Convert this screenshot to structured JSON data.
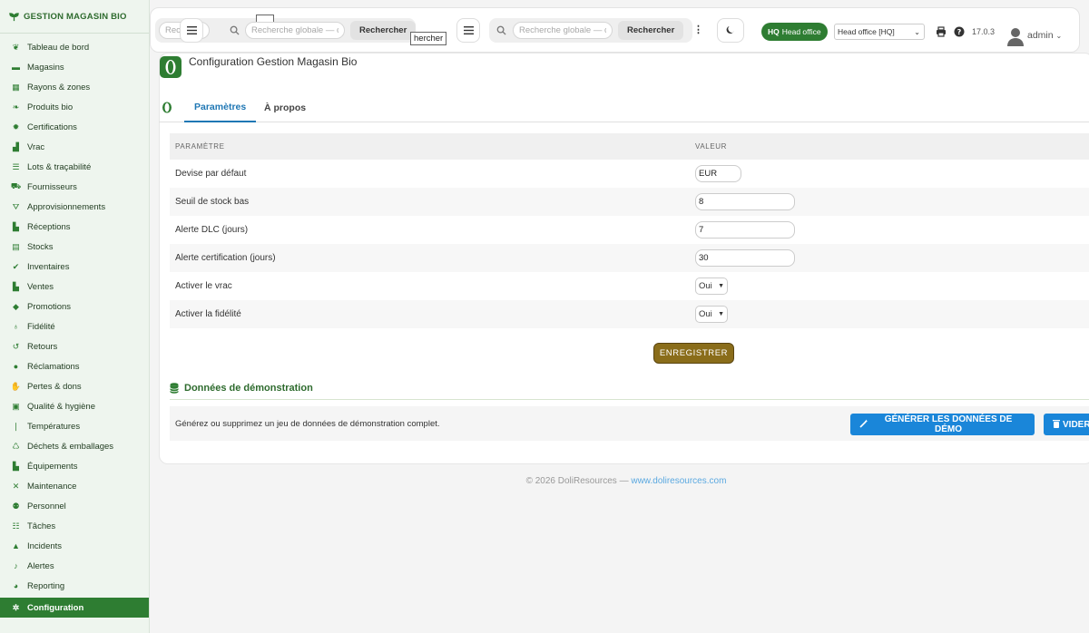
{
  "brand": {
    "name": "GESTION MAGASIN BIO"
  },
  "sidebar": {
    "items": [
      {
        "label": "Tableau de bord",
        "icon": "seedling-icon"
      },
      {
        "label": "Magasins",
        "icon": "store-icon"
      },
      {
        "label": "Rayons & zones",
        "icon": "grid-icon"
      },
      {
        "label": "Produits bio",
        "icon": "leaf-icon"
      },
      {
        "label": "Certifications",
        "icon": "certificate-icon"
      },
      {
        "label": "Vrac",
        "icon": "boxes-icon"
      },
      {
        "label": "Lots & traçabilité",
        "icon": "list-icon"
      },
      {
        "label": "Fournisseurs",
        "icon": "truck-icon"
      },
      {
        "label": "Approvisionnements",
        "icon": "cart-icon"
      },
      {
        "label": "Réceptions",
        "icon": "truck-loading-icon"
      },
      {
        "label": "Stocks",
        "icon": "warehouse-icon"
      },
      {
        "label": "Inventaires",
        "icon": "clipboard-check-icon"
      },
      {
        "label": "Ventes",
        "icon": "cash-register-icon"
      },
      {
        "label": "Promotions",
        "icon": "tags-icon"
      },
      {
        "label": "Fidélité",
        "icon": "award-icon"
      },
      {
        "label": "Retours",
        "icon": "undo-icon"
      },
      {
        "label": "Réclamations",
        "icon": "comment-icon"
      },
      {
        "label": "Pertes & dons",
        "icon": "hand-holding-icon"
      },
      {
        "label": "Qualité & hygiène",
        "icon": "clipboard-icon"
      },
      {
        "label": "Températures",
        "icon": "thermometer-icon"
      },
      {
        "label": "Déchets & emballages",
        "icon": "recycle-icon"
      },
      {
        "label": "Équipements",
        "icon": "blender-icon"
      },
      {
        "label": "Maintenance",
        "icon": "tools-icon"
      },
      {
        "label": "Personnel",
        "icon": "users-icon"
      },
      {
        "label": "Tâches",
        "icon": "tasks-icon"
      },
      {
        "label": "Incidents",
        "icon": "warning-icon"
      },
      {
        "label": "Alertes",
        "icon": "bell-icon"
      },
      {
        "label": "Reporting",
        "icon": "chart-pie-icon"
      },
      {
        "label": "Configuration",
        "icon": "gear-icon",
        "active": true
      }
    ]
  },
  "topbar": {
    "search1_placeholder": "Recherche globale — cl",
    "search2_placeholder": "Recherche globale — cl",
    "search_left_placeholder": "Recherche g",
    "search_button": "Rechercher",
    "tooltip_text": "hercher",
    "hq_badge_code": "HQ",
    "hq_badge_label": "Head office",
    "entity_selected": "Head office [HQ]",
    "version": "17.0.3",
    "user": "admin"
  },
  "page": {
    "title": "Configuration Gestion Magasin Bio",
    "tabs": [
      {
        "label": "Paramètres",
        "active": true
      },
      {
        "label": "À propos",
        "active": false
      }
    ]
  },
  "params": {
    "headers": {
      "param": "PARAMÈTRE",
      "value": "VALEUR"
    },
    "rows": [
      {
        "label": "Devise par défaut",
        "type": "input-short",
        "value": "EUR"
      },
      {
        "label": "Seuil de stock bas",
        "type": "input",
        "value": "8"
      },
      {
        "label": "Alerte DLC (jours)",
        "type": "input",
        "value": "7"
      },
      {
        "label": "Alerte certification (jours)",
        "type": "input",
        "value": "30"
      },
      {
        "label": "Activer le vrac",
        "type": "select",
        "value": "Oui"
      },
      {
        "label": "Activer la fidélité",
        "type": "select",
        "value": "Oui"
      }
    ],
    "save_button": "ENREGISTRER"
  },
  "demo": {
    "title": "Données de démonstration",
    "description": "Générez ou supprimez un jeu de données de démonstration complet.",
    "generate_button": "GÉNÉRER LES DONNÉES DE DÉMO",
    "clear_button": "VIDER"
  },
  "footer": {
    "text": "© 2026 DoliResources — ",
    "link": "www.doliresources.com"
  },
  "colors": {
    "brand_green": "#2e7d32",
    "save_button": "#8a6d1a",
    "demo_button": "#1a86d9",
    "tab_active": "#1f77b4"
  }
}
